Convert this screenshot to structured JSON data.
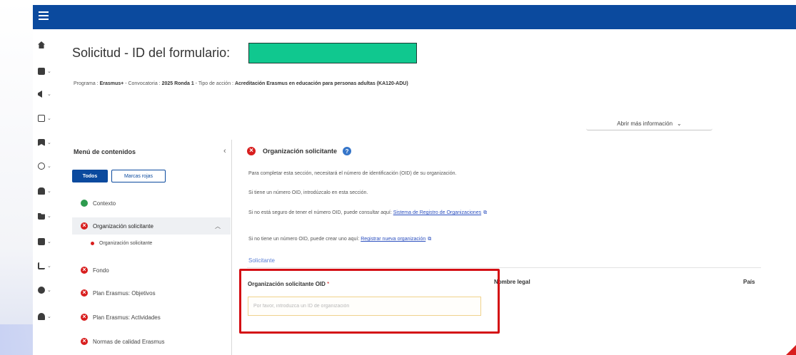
{
  "header": {
    "menu_icon": "hamburger-icon"
  },
  "rail": {
    "icons": [
      "home-icon",
      "building-icon",
      "megaphone-icon",
      "document-icon",
      "bookmark-icon",
      "globe-icon",
      "car-icon",
      "folder-icon",
      "briefcase-icon",
      "chart-icon",
      "help-icon",
      "users-icon"
    ]
  },
  "page": {
    "title": "Solicitud - ID del formulario:",
    "meta": {
      "programa_label": "Programa :",
      "programa": "Erasmus+",
      "convocatoria_label": "- Convocatoria :",
      "convocatoria": "2025 Ronda 1",
      "accion_label": "- Tipo de acción :",
      "accion": "Acreditación Erasmus en educación para personas adultas (KA120-ADU)"
    },
    "more_info": "Abrir más información"
  },
  "menu": {
    "title": "Menú de contenidos",
    "btn_all": "Todos",
    "btn_mark": "Marcas rojas",
    "items": [
      {
        "label": "Contexto",
        "status": "ok"
      },
      {
        "label": "Organización solicitante",
        "status": "error",
        "expanded": true
      },
      {
        "label": "Organización solicitante",
        "status": "error",
        "sub": true
      },
      {
        "label": "Fondo",
        "status": "error"
      },
      {
        "label": "Plan Erasmus: Objetivos",
        "status": "error"
      },
      {
        "label": "Plan Erasmus: Actividades",
        "status": "error"
      },
      {
        "label": "Normas de calidad Erasmus",
        "status": "error"
      }
    ]
  },
  "section": {
    "title": "Organización solicitante",
    "p1": "Para completar esta sección, necesitará el número de identificación (OID) de su organización.",
    "p2": "Si tiene un número OID, introdúzcalo en esta sección.",
    "p3_text": "Si no está seguro de tener el número OID, puede consultar aquí:",
    "p3_link": "Sistema de Registro de Organizaciones",
    "p4_text": "Si no tiene un número OID, puede crear uno aquí:",
    "p4_link": "Registrar nueva organización",
    "tab": "Solicitante",
    "field_label": "Organización solicitante OID",
    "field_required": "*",
    "field_placeholder": "Por favor, introduzca un ID de organización",
    "col_legal": "Nombre legal",
    "col_pais": "País"
  },
  "colors": {
    "brand": "#0b4a9e",
    "error": "#d81e1e",
    "ok": "#2d9b4e",
    "highlight": "#d40f14",
    "redaction": "#10c88f"
  }
}
